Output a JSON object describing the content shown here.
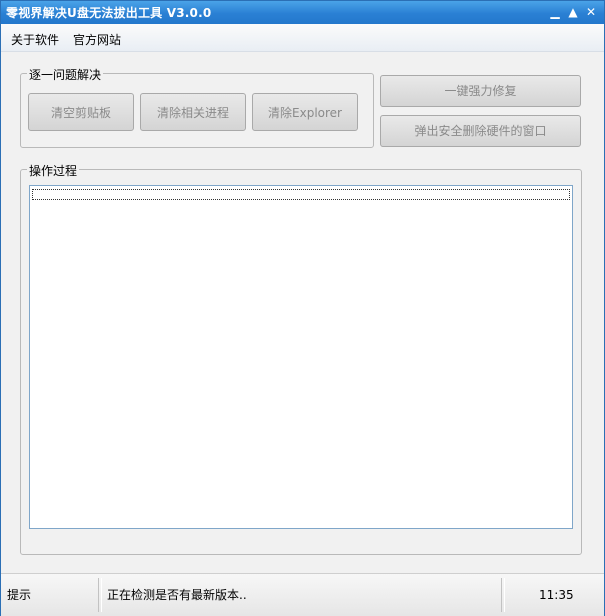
{
  "window": {
    "title": "零视界解决U盘无法拔出工具 V3.0.0",
    "controls": {
      "minimize": "▁",
      "maximize": "▲",
      "close": "✕"
    }
  },
  "menu": {
    "items": [
      "关于软件",
      "官方网站"
    ]
  },
  "step_group": {
    "label": "逐一问题解决",
    "buttons": [
      "清空剪贴板",
      "清除相关进程",
      "清除Explorer"
    ]
  },
  "side_buttons": [
    "一键强力修复",
    "弹出安全删除硬件的窗口"
  ],
  "process_group": {
    "label": "操作过程"
  },
  "status": {
    "hint": "提示",
    "message": "正在检测是否有最新版本..",
    "time": "11:35"
  },
  "colors": {
    "titlebar": "#2a80d4",
    "window_bg": "#f1f1f1",
    "disabled_text": "#8a8a8a"
  }
}
